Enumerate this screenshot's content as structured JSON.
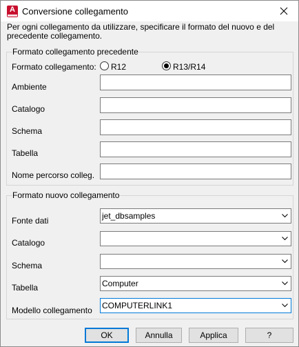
{
  "window": {
    "title": "Conversione collegamento",
    "app_icon_letter": "A"
  },
  "description": "Per ogni collegamento da utilizzare, specificare il formato del nuovo e del precedente collegamento.",
  "old_link": {
    "legend": "Formato collegamento precedente",
    "format_label": "Formato collegamento:",
    "radio_r12": "R12",
    "radio_r13": "R13/R14",
    "selected_format": "R13/R14",
    "fields": {
      "ambiente": {
        "label": "Ambiente",
        "value": ""
      },
      "catalogo": {
        "label": "Catalogo",
        "value": ""
      },
      "schema": {
        "label": "Schema",
        "value": ""
      },
      "tabella": {
        "label": "Tabella",
        "value": ""
      },
      "percorso": {
        "label": "Nome percorso colleg.",
        "value": ""
      }
    }
  },
  "new_link": {
    "legend": "Formato nuovo collegamento",
    "fields": {
      "fonte": {
        "label": "Fonte dati",
        "value": "jet_dbsamples"
      },
      "catalogo": {
        "label": "Catalogo",
        "value": ""
      },
      "schema": {
        "label": "Schema",
        "value": ""
      },
      "tabella": {
        "label": "Tabella",
        "value": "Computer"
      },
      "modello": {
        "label": "Modello collegamento",
        "value": "COMPUTERLINK1"
      }
    }
  },
  "buttons": {
    "ok": "OK",
    "cancel": "Annulla",
    "apply": "Applica",
    "help": "?"
  },
  "colors": {
    "accent": "#0078d7",
    "app_icon": "#c8102e",
    "background": "#f0f0f0"
  }
}
